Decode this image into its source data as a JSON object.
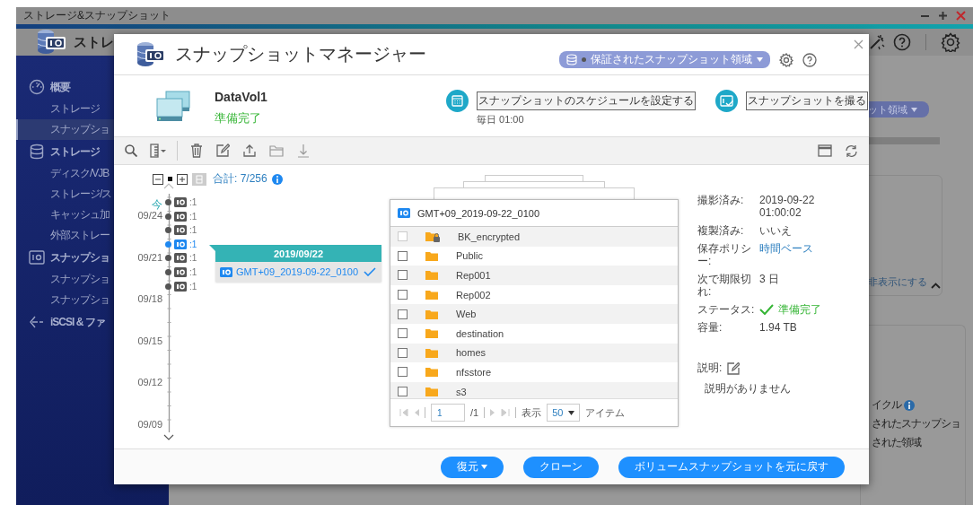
{
  "app_window": {
    "title": "ストレージ&スナップショット"
  },
  "app_header": {
    "title": "ストレ"
  },
  "sidebar": {
    "groups": [
      {
        "label": "概要",
        "children": [
          {
            "label": "ストレージ",
            "selected": false
          },
          {
            "label": "スナップショ",
            "selected": true
          }
        ]
      },
      {
        "label": "ストレージ",
        "children": [
          {
            "label": "ディスク/VJB",
            "selected": false
          },
          {
            "label": "ストレージ/ス",
            "selected": false
          },
          {
            "label": "キャッシュ加",
            "selected": false
          },
          {
            "label": "外部ストレー",
            "selected": false
          }
        ]
      },
      {
        "label": "スナップショ",
        "children": [
          {
            "label": "スナップショ",
            "selected": false
          },
          {
            "label": "スナップショ",
            "selected": false
          }
        ]
      },
      {
        "label": "iSCSI & ファ"
      }
    ]
  },
  "background_panel": {
    "pool_selector": "ット領域",
    "hide_link": "非表示にする",
    "card_title": "イクル",
    "card_lines": [
      "されたスナップショ",
      "された領域"
    ]
  },
  "snapshot_manager": {
    "title": "スナップショットマネージャー",
    "pool_selector": "保証されたスナップショット領域",
    "volume": {
      "name": "DataVol1",
      "status": "準備完了"
    },
    "schedule": {
      "label": "スナップショットのスケジュールを設定する",
      "detail": "毎日 01:00"
    },
    "take_snapshot": {
      "label": "スナップショットを撮る"
    },
    "timeline": {
      "total": "合計: 7/256",
      "now_label": "今",
      "date_labels": [
        "09/24",
        "09/21",
        "09/18",
        "09/15",
        "09/12",
        "09/09"
      ],
      "snapshots": [
        {
          "count": ":1",
          "selected": false
        },
        {
          "count": ":1",
          "selected": false
        },
        {
          "count": ":1",
          "selected": false
        },
        {
          "count": ":1",
          "selected": true
        },
        {
          "count": ":1",
          "selected": false
        },
        {
          "count": ":1",
          "selected": false
        },
        {
          "count": ":1",
          "selected": false
        }
      ],
      "popup": {
        "date": "2019/09/22",
        "items": [
          {
            "name": "GMT+09_2019-09-22_0100",
            "checked": true
          }
        ]
      }
    },
    "file_list": {
      "title": "GMT+09_2019-09-22_0100",
      "rows": [
        {
          "name": "BK_encrypted",
          "kind": "locked",
          "checked": false,
          "disabled": true
        },
        {
          "name": "Public",
          "kind": "folder",
          "checked": false,
          "disabled": false
        },
        {
          "name": "Rep001",
          "kind": "folder",
          "checked": false,
          "disabled": false
        },
        {
          "name": "Rep002",
          "kind": "folder",
          "checked": false,
          "disabled": false
        },
        {
          "name": "Web",
          "kind": "folder",
          "checked": false,
          "disabled": false
        },
        {
          "name": "destination",
          "kind": "folder",
          "checked": false,
          "disabled": false
        },
        {
          "name": "homes",
          "kind": "folder",
          "checked": false,
          "disabled": false
        },
        {
          "name": "nfsstore",
          "kind": "folder",
          "checked": false,
          "disabled": false
        },
        {
          "name": "s3",
          "kind": "folder",
          "checked": false,
          "disabled": false
        }
      ],
      "pagination": {
        "page": "1",
        "page_total": "/1",
        "show_label": "表示",
        "page_size": "50",
        "items_label": "アイテム"
      }
    },
    "details": {
      "fields": [
        {
          "label": "撮影済み:",
          "value": "2019-09-22 01:00:02",
          "kind": "text"
        },
        {
          "label": "複製済み:",
          "value": "いいえ",
          "kind": "text"
        },
        {
          "label": "保存ポリシー:",
          "value": "時間ベース",
          "kind": "link"
        },
        {
          "label": "次で期限切れ:",
          "value": "3 日",
          "kind": "text"
        },
        {
          "label": "ステータス:",
          "value": "準備完了",
          "kind": "status"
        },
        {
          "label": "容量:",
          "value": "1.94 TB",
          "kind": "text"
        }
      ],
      "description_label": "説明:",
      "description": "説明がありません"
    },
    "buttons": [
      {
        "label": "復元",
        "dropdown": true
      },
      {
        "label": "クローン",
        "dropdown": false
      },
      {
        "label": "ボリュームスナップショットを元に戻す",
        "dropdown": false
      }
    ]
  }
}
